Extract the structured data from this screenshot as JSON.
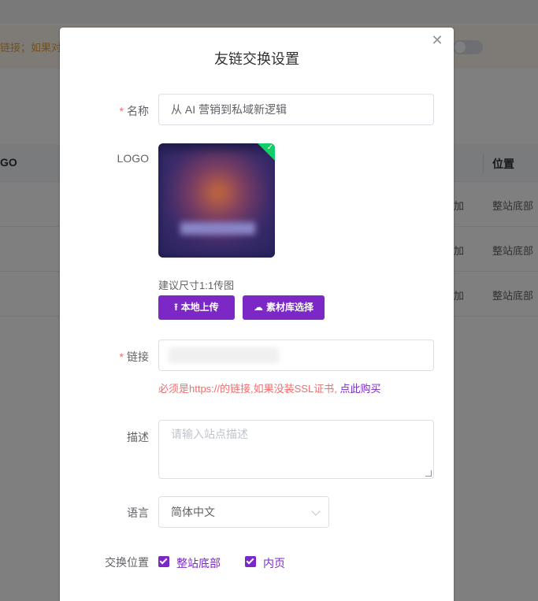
{
  "background": {
    "notice_text": "链接；如果对方",
    "table_headers": {
      "logo": "GO",
      "position": "位置"
    },
    "rows": [
      {
        "col_a": "加",
        "col_b": "整站底部"
      },
      {
        "col_a": "加",
        "col_b": "整站底部"
      },
      {
        "col_a": "加",
        "col_b": "整站底部"
      }
    ]
  },
  "dialog": {
    "title": "友链交换设置",
    "close_icon": "close-icon",
    "name": {
      "label": "名称",
      "required_mark": "*",
      "value": "从 AI 营销到私域新逻辑"
    },
    "logo": {
      "label": "LOGO",
      "size_hint": "建议尺寸1:1传图",
      "upload_button": "本地上传",
      "library_button": "素材库选择",
      "upload_icon": "upload-icon",
      "library_icon": "cloud-upload-icon"
    },
    "link": {
      "label": "链接",
      "required_mark": "*",
      "error_text": "必须是https://的链接,如果没装SSL证书, ",
      "error_link_text": "点此购买"
    },
    "description": {
      "label": "描述",
      "placeholder": "请输入站点描述"
    },
    "language": {
      "label": "语言",
      "selected": "简体中文"
    },
    "exchange_position": {
      "label": "交换位置",
      "options": [
        {
          "label": "整站底部",
          "checked": true
        },
        {
          "label": "内页",
          "checked": true
        }
      ]
    }
  },
  "colors": {
    "accent": "#7b28c6",
    "error": "#f56c6c",
    "check_badge": "#13ce66"
  }
}
